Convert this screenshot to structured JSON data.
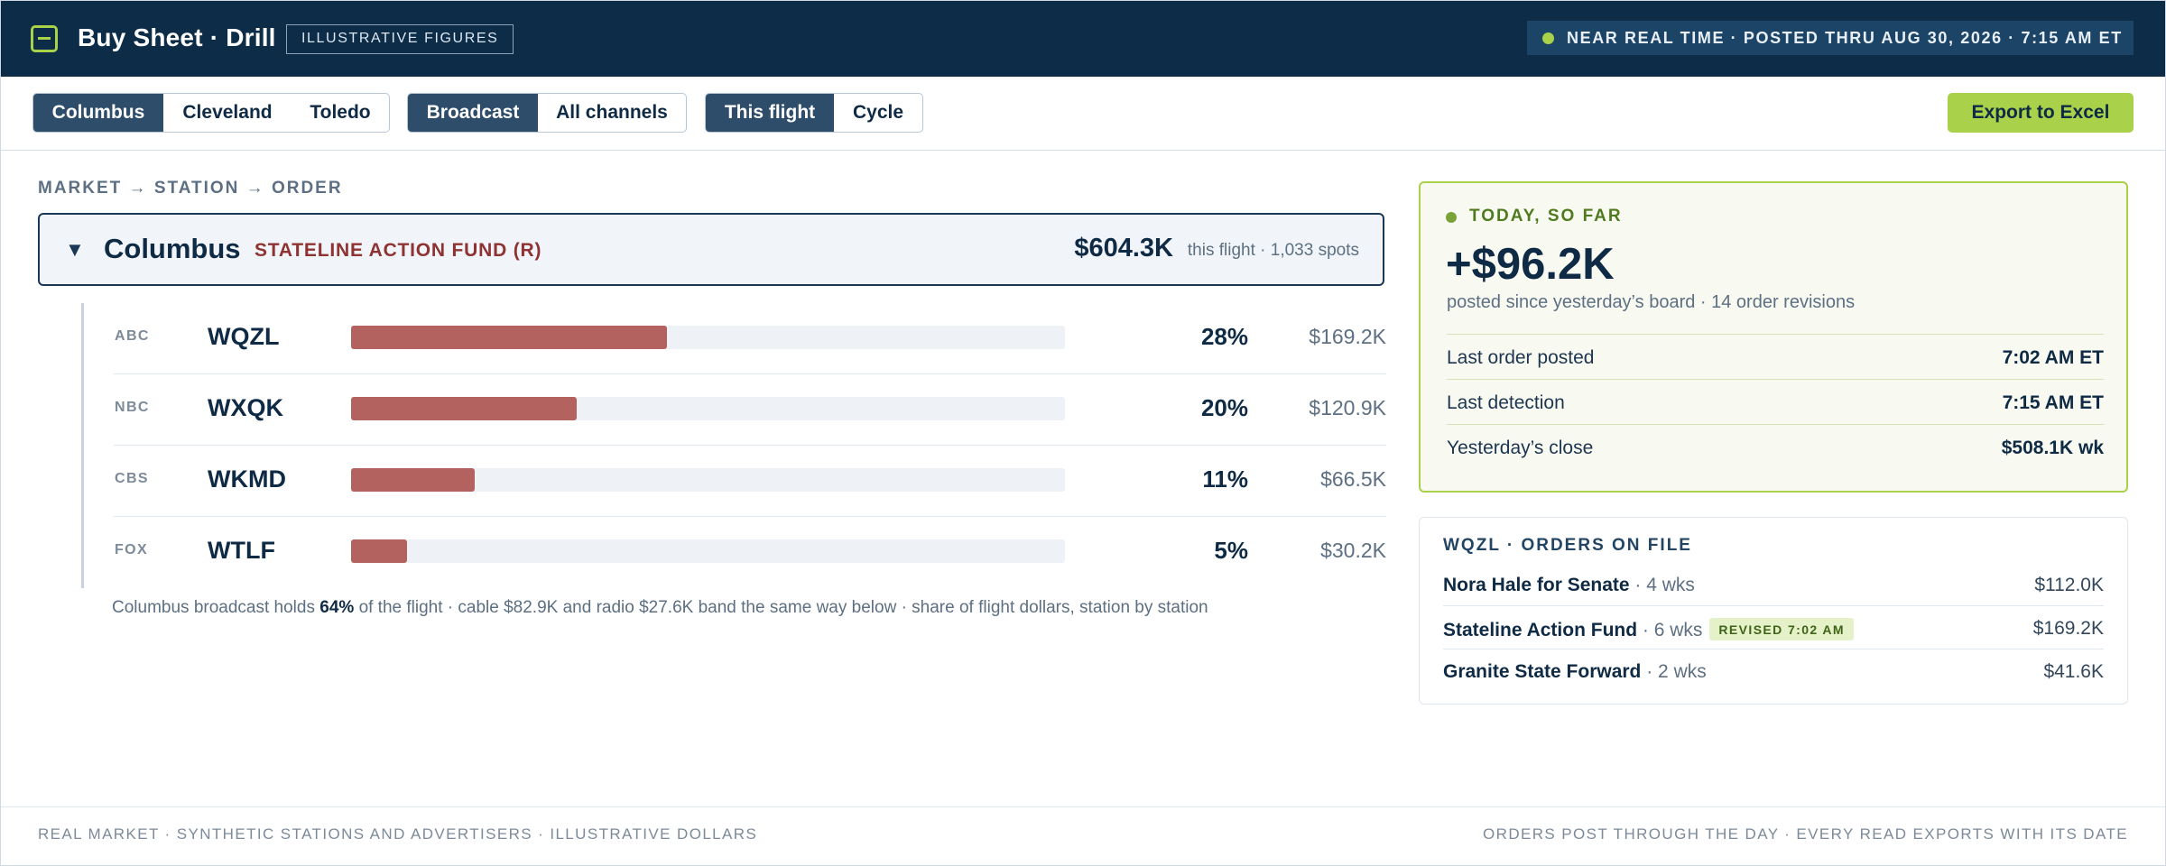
{
  "header": {
    "title": "Buy Sheet · Drill",
    "badge": "ILLUSTRATIVE FIGURES",
    "status": "NEAR REAL TIME · POSTED THRU AUG 30, 2026 · 7:15 AM ET",
    "logo_icon": "collapse-square-icon",
    "accent_color": "#a9d14a"
  },
  "toolbar": {
    "markets": [
      {
        "label": "Columbus",
        "selected": true
      },
      {
        "label": "Cleveland",
        "selected": false
      },
      {
        "label": "Toledo",
        "selected": false
      }
    ],
    "channels": [
      {
        "label": "Broadcast",
        "selected": true
      },
      {
        "label": "All channels",
        "selected": false
      }
    ],
    "periods": [
      {
        "label": "This flight",
        "selected": true
      },
      {
        "label": "Cycle",
        "selected": false
      }
    ],
    "export_label": "Export to Excel"
  },
  "drill": {
    "breadcrumb": "MARKET → STATION → ORDER",
    "market": {
      "name": "Columbus",
      "advertiser": "STATELINE ACTION FUND (R)",
      "total": "$604.3K",
      "sub": "this flight · 1,033 spots",
      "expanded": true
    },
    "stations": [
      {
        "network": "ABC",
        "call": "WQZL",
        "share": 0.28,
        "pct": "28%",
        "dollars": "$169.2K"
      },
      {
        "network": "NBC",
        "call": "WXQK",
        "share": 0.2,
        "pct": "20%",
        "dollars": "$120.9K"
      },
      {
        "network": "CBS",
        "call": "WKMD",
        "share": 0.11,
        "pct": "11%",
        "dollars": "$66.5K"
      },
      {
        "network": "FOX",
        "call": "WTLF",
        "share": 0.05,
        "pct": "5%",
        "dollars": "$30.2K"
      }
    ],
    "bar_color": "#b4625f",
    "footnote": {
      "before": "Columbus broadcast holds",
      "highlight": "64%",
      "after": "of the flight · cable $82.9K and radio $27.6K band the same way below · share of flight dollars, station by station"
    }
  },
  "today": {
    "heading": "TODAY, SO FAR",
    "value": "+$96.2K",
    "sub": "posted since yesterday’s board · 14 order revisions",
    "rows": [
      {
        "label": "Last order posted",
        "value": "7:02 AM ET"
      },
      {
        "label": "Last detection",
        "value": "7:15 AM ET"
      },
      {
        "label": "Yesterday’s close",
        "value": "$508.1K wk"
      }
    ]
  },
  "orders": {
    "heading": "WQZL · ORDERS ON FILE",
    "items": [
      {
        "name": "Nora Hale for Senate",
        "meta": "· 4 wks",
        "badge": "",
        "amount": "$112.0K"
      },
      {
        "name": "Stateline Action Fund",
        "meta": "· 6 wks",
        "badge": "REVISED 7:02 AM",
        "amount": "$169.2K"
      },
      {
        "name": "Granite State Forward",
        "meta": "· 2 wks",
        "badge": "",
        "amount": "$41.6K"
      }
    ]
  },
  "footer": {
    "left": "REAL MARKET · SYNTHETIC STATIONS AND ADVERTISERS · ILLUSTRATIVE DOLLARS",
    "right": "ORDERS POST THROUGH THE DAY · EVERY READ EXPORTS WITH ITS DATE"
  }
}
